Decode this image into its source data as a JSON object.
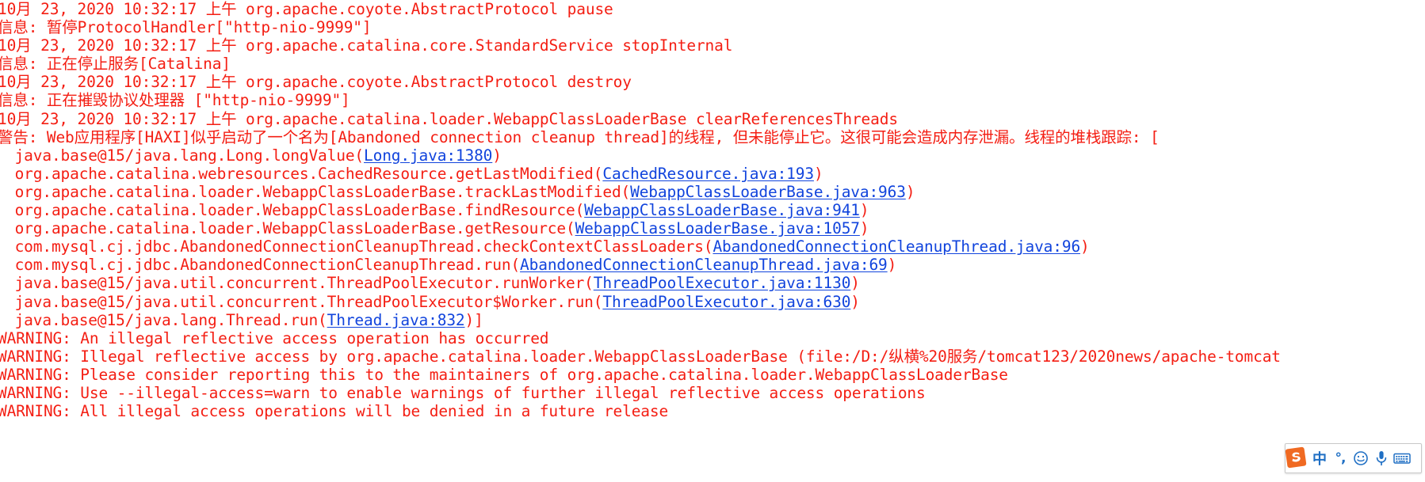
{
  "window": {
    "kind": "java-console-output",
    "text_color": "#f41e13",
    "link_color": "#1144dd",
    "background": "#ffffff"
  },
  "console": {
    "lines": [
      {
        "id": "l1",
        "indent": "flush",
        "text": "10月 23, 2020 10:32:17 上午 org.apache.coyote.AbstractProtocol pause"
      },
      {
        "id": "l2",
        "indent": "flush",
        "text": "信息: 暂停ProtocolHandler[\"http-nio-9999\"]"
      },
      {
        "id": "l3",
        "indent": "flush",
        "text": "10月 23, 2020 10:32:17 上午 org.apache.catalina.core.StandardService stopInternal"
      },
      {
        "id": "l4",
        "indent": "flush",
        "text": "信息: 正在停止服务[Catalina]"
      },
      {
        "id": "l5",
        "indent": "flush",
        "text": "10月 23, 2020 10:32:17 上午 org.apache.coyote.AbstractProtocol destroy"
      },
      {
        "id": "l6",
        "indent": "flush",
        "text": "信息: 正在摧毁协议处理器 [\"http-nio-9999\"]"
      },
      {
        "id": "l7",
        "indent": "flush",
        "text": "10月 23, 2020 10:32:17 上午 org.apache.catalina.loader.WebappClassLoaderBase clearReferencesThreads"
      },
      {
        "id": "l8",
        "indent": "flush",
        "text": "警告: Web应用程序[HAXI]似乎启动了一个名为[Abandoned connection cleanup thread]的线程, 但未能停止它。这很可能会造成内存泄漏。线程的堆栈跟踪: ["
      },
      {
        "id": "l9",
        "indent": "indent1",
        "pre": " java.base@15/java.lang.Long.longValue(",
        "link": "Long.java:1380",
        "post": ")"
      },
      {
        "id": "l10",
        "indent": "indent1",
        "pre": " org.apache.catalina.webresources.CachedResource.getLastModified(",
        "link": "CachedResource.java:193",
        "post": ")"
      },
      {
        "id": "l11",
        "indent": "indent1",
        "pre": " org.apache.catalina.loader.WebappClassLoaderBase.trackLastModified(",
        "link": "WebappClassLoaderBase.java:963",
        "post": ")"
      },
      {
        "id": "l12",
        "indent": "indent1",
        "pre": " org.apache.catalina.loader.WebappClassLoaderBase.findResource(",
        "link": "WebappClassLoaderBase.java:941",
        "post": ")"
      },
      {
        "id": "l13",
        "indent": "indent1",
        "pre": " org.apache.catalina.loader.WebappClassLoaderBase.getResource(",
        "link": "WebappClassLoaderBase.java:1057",
        "post": ")"
      },
      {
        "id": "l14",
        "indent": "indent1",
        "pre": " com.mysql.cj.jdbc.AbandonedConnectionCleanupThread.checkContextClassLoaders(",
        "link": "AbandonedConnectionCleanupThread.java:96",
        "post": ")"
      },
      {
        "id": "l15",
        "indent": "indent1",
        "pre": " com.mysql.cj.jdbc.AbandonedConnectionCleanupThread.run(",
        "link": "AbandonedConnectionCleanupThread.java:69",
        "post": ")"
      },
      {
        "id": "l16",
        "indent": "indent1",
        "pre": " java.base@15/java.util.concurrent.ThreadPoolExecutor.runWorker(",
        "link": "ThreadPoolExecutor.java:1130",
        "post": ")"
      },
      {
        "id": "l17",
        "indent": "indent1",
        "pre": " java.base@15/java.util.concurrent.ThreadPoolExecutor$Worker.run(",
        "link": "ThreadPoolExecutor.java:630",
        "post": ")"
      },
      {
        "id": "l18",
        "indent": "indent1",
        "pre": " java.base@15/java.lang.Thread.run(",
        "link": "Thread.java:832",
        "post": ")]"
      },
      {
        "id": "l19",
        "indent": "flush",
        "text": "WARNING: An illegal reflective access operation has occurred"
      },
      {
        "id": "l20",
        "indent": "flush",
        "text": "WARNING: Illegal reflective access by org.apache.catalina.loader.WebappClassLoaderBase (file:/D:/纵横%20服务/tomcat123/2020news/apache-tomcat"
      },
      {
        "id": "l21",
        "indent": "flush",
        "text": "WARNING: Please consider reporting this to the maintainers of org.apache.catalina.loader.WebappClassLoaderBase"
      },
      {
        "id": "l22",
        "indent": "flush",
        "text": "WARNING: Use --illegal-access=warn to enable warnings of further illegal reflective access operations"
      },
      {
        "id": "l23",
        "indent": "flush",
        "text": "WARNING: All illegal access operations will be denied in a future release"
      }
    ]
  },
  "ime_toolbar": {
    "name": "Sogou Pinyin input method floating bar",
    "logo_label": "S",
    "logo_color": "#f06a22",
    "icon_color": "#1f6fc4",
    "items": [
      {
        "id": "sogou-logo",
        "label": "S",
        "title": "sogou-logo"
      },
      {
        "id": "input-mode",
        "label": "中",
        "title": "chinese-mode"
      },
      {
        "id": "punctuation",
        "label": "°,",
        "title": "punctuation-mode"
      },
      {
        "id": "emoji",
        "label": "",
        "title": "emoji-panel"
      },
      {
        "id": "voice",
        "label": "",
        "title": "voice-input"
      },
      {
        "id": "soft-keyboard",
        "label": "",
        "title": "soft-keyboard"
      }
    ]
  }
}
